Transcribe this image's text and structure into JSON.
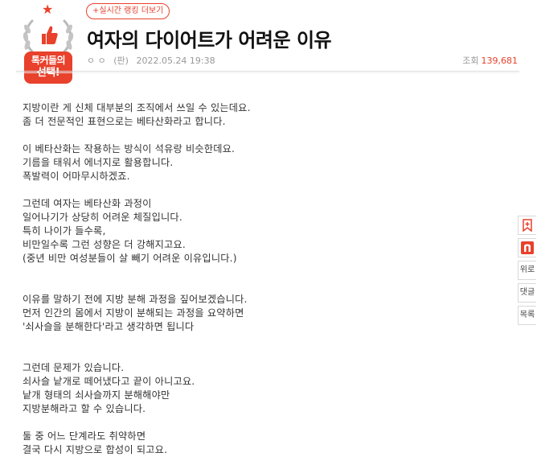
{
  "badge": {
    "line1": "톡커들의",
    "line2": "선택!",
    "color": "#e8412c"
  },
  "ranking_link": "+실시간 랭킹 더보기",
  "title": "여자의 다이어트가 어려운 이유",
  "meta": {
    "author": "ㅇ ㅇ",
    "tag": "(판)",
    "date": "2022.05.24 19:38"
  },
  "views": {
    "label": "조회",
    "count": "139,681"
  },
  "body_lines": [
    "지방이란 게 신체 대부분의 조직에서 쓰일 수 있는데요.",
    "좀 더 전문적인 표현으로는 베타산화라고 합니다.",
    "",
    "이 베타산화는 작용하는 방식이 석유랑 비슷한데요.",
    "기름을 태워서 에너지로 활용합니다.",
    "폭발력이 어마무시하겠죠.",
    "",
    "그런데 여자는 베타산화 과정이",
    "일어나기가 상당히 어려운 체질입니다.",
    "특히 나이가 들수록,",
    "비만일수록 그런 성향은 더 강해지고요.",
    "(중년 비만 여성분들이 살 빼기 어려운 이유입니다.)",
    "",
    "",
    "이유를 말하기 전에 지방 분해 과정을 짚어보겠습니다.",
    "먼저 인간의 몸에서 지방이 분해되는 과정을 요약하면",
    "'쇠사슬을 분해한다'라고 생각하면 됩니다",
    "",
    "",
    "그런데 문제가 있습니다.",
    "쇠사슬 낱개로 떼어냈다고 끝이 아니고요.",
    "낱개 형태의 쇠사슬까지 분해해야만",
    "지방분해라고 할 수 있습니다.",
    "",
    "둘 중 어느 단계라도 취약하면",
    "결국 다시 지방으로 합성이 되고요."
  ],
  "side": {
    "up_label": "위로",
    "comment_label": "댓글",
    "list_label": "목록"
  }
}
